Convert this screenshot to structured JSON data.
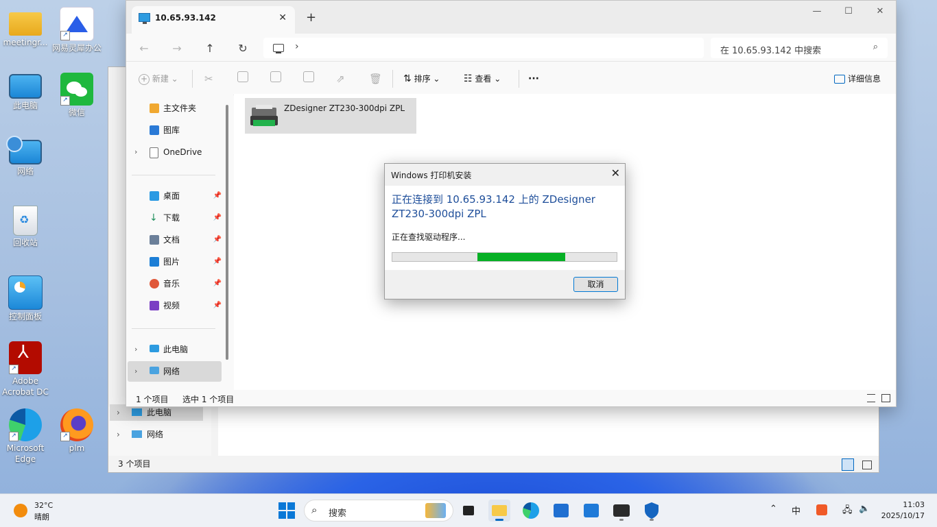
{
  "desktop": {
    "icons": [
      {
        "label": "meetingr...",
        "icon": "folder-icon"
      },
      {
        "label": "网易灵犀办公",
        "icon": "lingxi-app-icon"
      },
      {
        "label": "此电脑",
        "icon": "computer-icon"
      },
      {
        "label": "微信",
        "icon": "wechat-icon"
      },
      {
        "label": "网络",
        "icon": "network-icon"
      },
      {
        "label": "回收站",
        "icon": "recycle-bin-icon"
      },
      {
        "label": "控制面板",
        "icon": "control-panel-icon"
      },
      {
        "label": "Adobe Acrobat DC",
        "icon": "acrobat-icon"
      },
      {
        "label": "Microsoft Edge",
        "icon": "edge-icon"
      },
      {
        "label": "plm",
        "icon": "firefox-icon"
      }
    ]
  },
  "back_window": {
    "nav": [
      {
        "label": "此电脑"
      },
      {
        "label": "网络"
      }
    ],
    "status": "3 个项目"
  },
  "explorer": {
    "tab_title": "10.65.93.142",
    "search_placeholder": "在 10.65.93.142 中搜索",
    "toolbar": {
      "new": "新建",
      "sort": "排序",
      "view": "查看",
      "more": "···",
      "details": "详细信息"
    },
    "nav": {
      "home": "主文件夹",
      "gallery": "图库",
      "onedrive": "OneDrive",
      "desktop": "桌面",
      "downloads": "下载",
      "documents": "文档",
      "pictures": "图片",
      "music": "音乐",
      "videos": "视频",
      "this_pc": "此电脑",
      "network": "网络"
    },
    "files": [
      {
        "name": "ZDesigner ZT230-300dpi ZPL"
      }
    ],
    "status": {
      "count": "1 个项目",
      "selected": "选中 1 个项目"
    }
  },
  "dialog": {
    "title": "Windows 打印机安装",
    "heading": "正在连接到 10.65.93.142 上的 ZDesigner ZT230-300dpi ZPL",
    "message": "正在查找驱动程序...",
    "progress_start": 0.38,
    "progress_end": 0.77,
    "cancel": "取消",
    "progress_color": "#06b025"
  },
  "taskbar": {
    "weather_temp": "32°C",
    "weather_desc": "晴朗",
    "search_placeholder": "搜索",
    "ime": "中",
    "time": "11:03",
    "date": "2025/10/17"
  }
}
